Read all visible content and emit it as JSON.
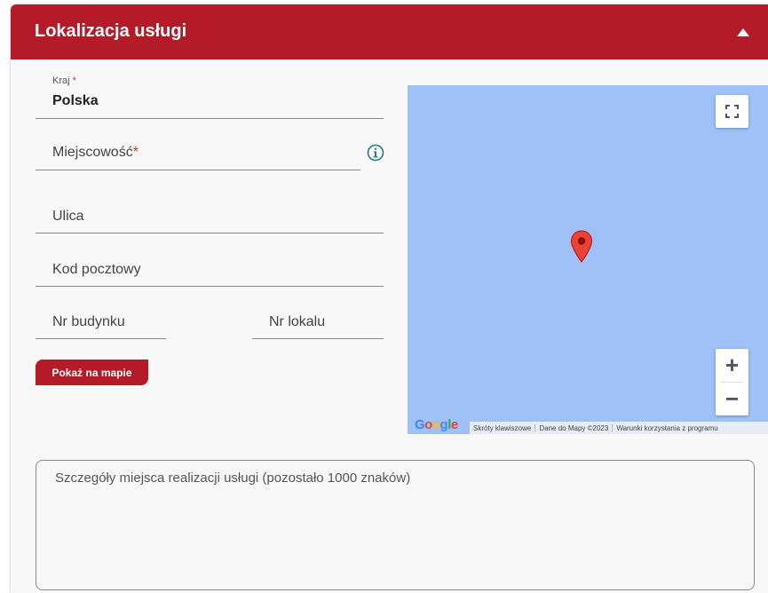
{
  "header": {
    "title": "Lokalizacja usługi"
  },
  "form": {
    "country": {
      "label": "Kraj",
      "required_mark": "*",
      "value": "Polska"
    },
    "city": {
      "placeholder": "Miejscowość",
      "required_mark": "*"
    },
    "street": {
      "placeholder": "Ulica"
    },
    "postal_code": {
      "placeholder": "Kod pocztowy"
    },
    "building_no": {
      "placeholder": "Nr budynku"
    },
    "unit_no": {
      "placeholder": "Nr lokalu"
    },
    "show_on_map_button": "Pokaż na mapie"
  },
  "map": {
    "fullscreen_icon": "fullscreen-icon",
    "zoom_in_label": "+",
    "zoom_out_label": "−",
    "google_logo": "Google",
    "footer": {
      "shortcuts": "Skróty klawiszowe",
      "map_data": "Dane do Mapy ©2023",
      "terms": "Warunki korzystania z programu"
    },
    "colors": {
      "water": "#9fc1f8",
      "marker": "#ea4335"
    }
  },
  "details": {
    "placeholder": "Szczegóły miejsca realizacji usługi (pozostało 1000 znaków)"
  },
  "colors": {
    "brand": "#b51a28",
    "required": "#c0392b",
    "info_icon": "#2a7a8c"
  }
}
